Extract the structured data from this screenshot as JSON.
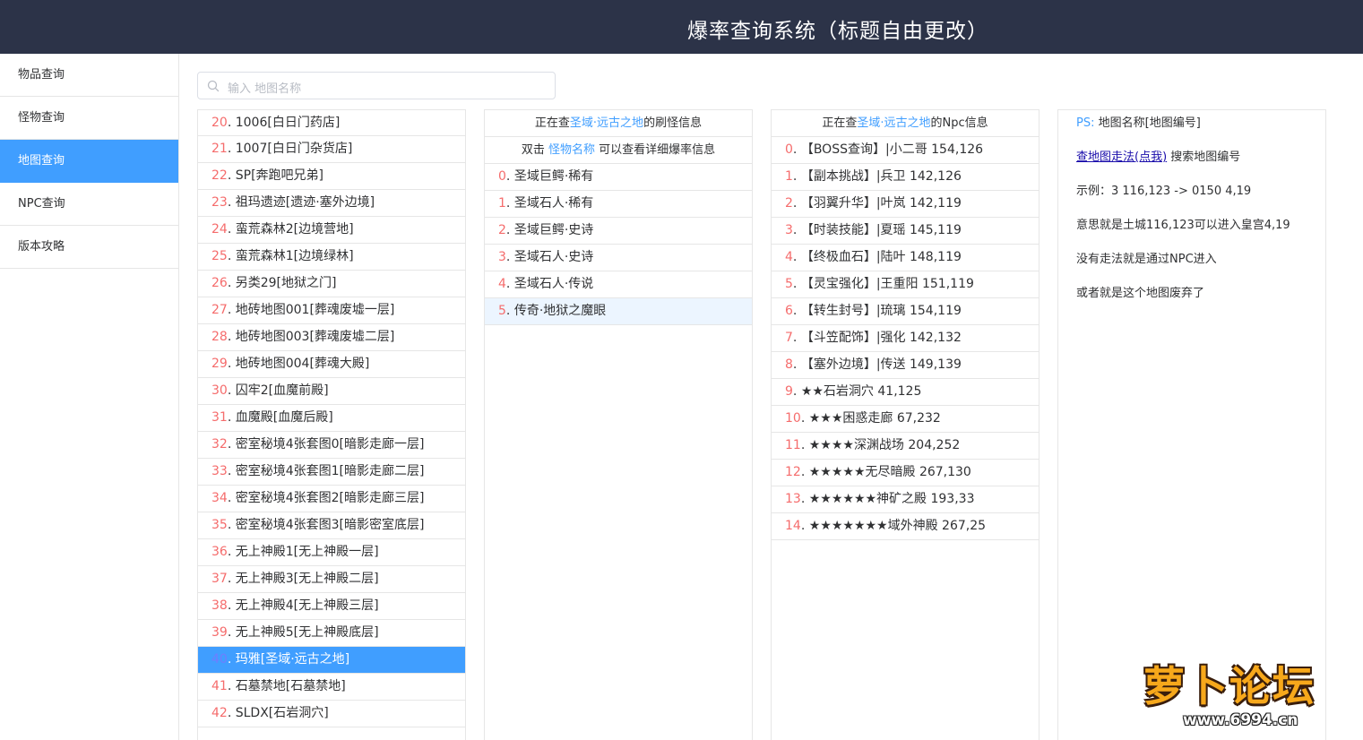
{
  "header": {
    "title": "爆率查询系统（标题自由更改）"
  },
  "sidebar": {
    "items": [
      {
        "label": "物品查询",
        "active": false
      },
      {
        "label": "怪物查询",
        "active": false
      },
      {
        "label": "地图查询",
        "active": true
      },
      {
        "label": "NPC查询",
        "active": false
      },
      {
        "label": "版本攻略",
        "active": false
      }
    ]
  },
  "search": {
    "placeholder": "输入 地图名称",
    "value": ""
  },
  "map_list": [
    {
      "idx": "20",
      "name": "1006[白日门药店]"
    },
    {
      "idx": "21",
      "name": "1007[白日门杂货店]"
    },
    {
      "idx": "22",
      "name": "SP[奔跑吧兄弟]"
    },
    {
      "idx": "23",
      "name": "祖玛遗迹[遗迹·塞外边境]"
    },
    {
      "idx": "24",
      "name": "蛮荒森林2[边境营地]"
    },
    {
      "idx": "25",
      "name": "蛮荒森林1[边境绿林]"
    },
    {
      "idx": "26",
      "name": "另类29[地狱之门]"
    },
    {
      "idx": "27",
      "name": "地砖地图001[葬魂废墟一层]"
    },
    {
      "idx": "28",
      "name": "地砖地图003[葬魂废墟二层]"
    },
    {
      "idx": "29",
      "name": "地砖地图004[葬魂大殿]"
    },
    {
      "idx": "30",
      "name": "囚牢2[血魔前殿]"
    },
    {
      "idx": "31",
      "name": "血魔殿[血魔后殿]"
    },
    {
      "idx": "32",
      "name": "密室秘境4张套图0[暗影走廊一层]"
    },
    {
      "idx": "33",
      "name": "密室秘境4张套图1[暗影走廊二层]"
    },
    {
      "idx": "34",
      "name": "密室秘境4张套图2[暗影走廊三层]"
    },
    {
      "idx": "35",
      "name": "密室秘境4张套图3[暗影密室底层]"
    },
    {
      "idx": "36",
      "name": "无上神殿1[无上神殿一层]"
    },
    {
      "idx": "37",
      "name": "无上神殿3[无上神殿二层]"
    },
    {
      "idx": "38",
      "name": "无上神殿4[无上神殿三层]"
    },
    {
      "idx": "39",
      "name": "无上神殿5[无上神殿底层]"
    },
    {
      "idx": "40",
      "name": "玛雅[圣域·远古之地]",
      "selected": true
    },
    {
      "idx": "41",
      "name": "石墓禁地[石墓禁地]"
    },
    {
      "idx": "42",
      "name": "SLDX[石岩洞穴]"
    }
  ],
  "monster_panel": {
    "header_prefix": "正在查",
    "header_map": "圣域·远古之地",
    "header_suffix": "的刷怪信息",
    "hint_prefix": "双击",
    "hint_link": "怪物名称",
    "hint_suffix": "可以查看详细爆率信息",
    "items": [
      {
        "idx": "0",
        "name": "圣域巨鳄·稀有"
      },
      {
        "idx": "1",
        "name": "圣域石人·稀有"
      },
      {
        "idx": "2",
        "name": "圣域巨鳄·史诗"
      },
      {
        "idx": "3",
        "name": "圣域石人·史诗"
      },
      {
        "idx": "4",
        "name": "圣域石人·传说"
      },
      {
        "idx": "5",
        "name": "传奇·地狱之魔眼",
        "highlighted": true
      }
    ]
  },
  "npc_panel": {
    "header_prefix": "正在查",
    "header_map": "圣域·远古之地",
    "header_suffix": "的Npc信息",
    "items": [
      {
        "idx": "0",
        "name": "【BOSS查询】|小二哥 154,126"
      },
      {
        "idx": "1",
        "name": "【副本挑战】|兵卫 142,126"
      },
      {
        "idx": "2",
        "name": "【羽翼升华】|叶岚 142,119"
      },
      {
        "idx": "3",
        "name": "【时装技能】|夏瑶 145,119"
      },
      {
        "idx": "4",
        "name": "【终极血石】|陆叶 148,119"
      },
      {
        "idx": "5",
        "name": "【灵宝强化】|王重阳 151,119"
      },
      {
        "idx": "6",
        "name": "【转生封号】|琉璃 154,119"
      },
      {
        "idx": "7",
        "name": "【斗笠配饰】|强化 142,132"
      },
      {
        "idx": "8",
        "name": "【塞外边境】|传送 149,139"
      },
      {
        "idx": "9",
        "name": "★★石岩洞穴 41,125"
      },
      {
        "idx": "10",
        "name": "★★★困惑走廊 67,232"
      },
      {
        "idx": "11",
        "name": "★★★★深渊战场 204,252"
      },
      {
        "idx": "12",
        "name": "★★★★★无尽暗殿 267,130"
      },
      {
        "idx": "13",
        "name": "★★★★★★神矿之殿 193,33"
      },
      {
        "idx": "14",
        "name": "★★★★★★★域外神殿 267,25"
      }
    ]
  },
  "info_panel": {
    "ps_label": "PS:",
    "ps_text": "地图名称[地图编号]",
    "link_text": "查地图走法(点我)",
    "link_suffix": "搜索地图编号",
    "example": "示例：3 116,123 -> 0150 4,19",
    "meaning": "意思就是土城116,123可以进入皇宫4,19",
    "no_route": "没有走法就是通过NPC进入",
    "abandoned": "或者就是这个地图废弃了"
  },
  "watermark": {
    "brand": "萝卜论坛",
    "url": "www.6994.cn"
  }
}
